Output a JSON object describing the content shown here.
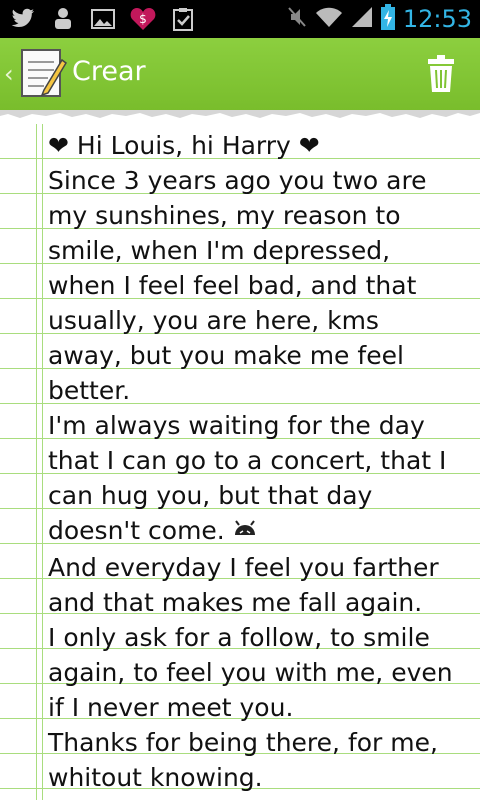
{
  "status_bar": {
    "time": "12:53",
    "notification_icons": [
      "twitter-icon",
      "tumblr-icon",
      "gallery-icon",
      "broken-heart-dollar-icon",
      "clipboard-check-icon"
    ],
    "system_icons": [
      "mute-icon",
      "wifi-icon",
      "signal-icon",
      "battery-charging-icon"
    ]
  },
  "action_bar": {
    "title": "Crear",
    "back_icon": "chevron-left-icon",
    "app_icon": "notepad-icon",
    "action_icon": "trash-icon"
  },
  "note": {
    "lines": [
      "❤ Hi Louis, hi Harry ❤",
      "Since 3 years ago you two are",
      "my sunshines, my reason to",
      "smile, when I'm depressed,",
      "when I feel feel bad, and that",
      "usually, you are here, kms",
      "away, but you make me feel",
      "better.",
      "I'm always waiting for the day",
      "that I can go to a concert, that I",
      "can hug you, but that day",
      "doesn't come. ",
      "And everyday I feel you farther",
      "and that makes me fall again.",
      "I only ask for a follow, to smile",
      "again, to feel you with me, even",
      "if I never meet you.",
      "Thanks for being there, for me,",
      "whitout knowing."
    ]
  },
  "colors": {
    "action_bar": "#80c434",
    "status_bar": "#000000",
    "clock": "#33b5e5",
    "rule_line": "#a9dd7e",
    "spell_underline": "#e53935"
  }
}
